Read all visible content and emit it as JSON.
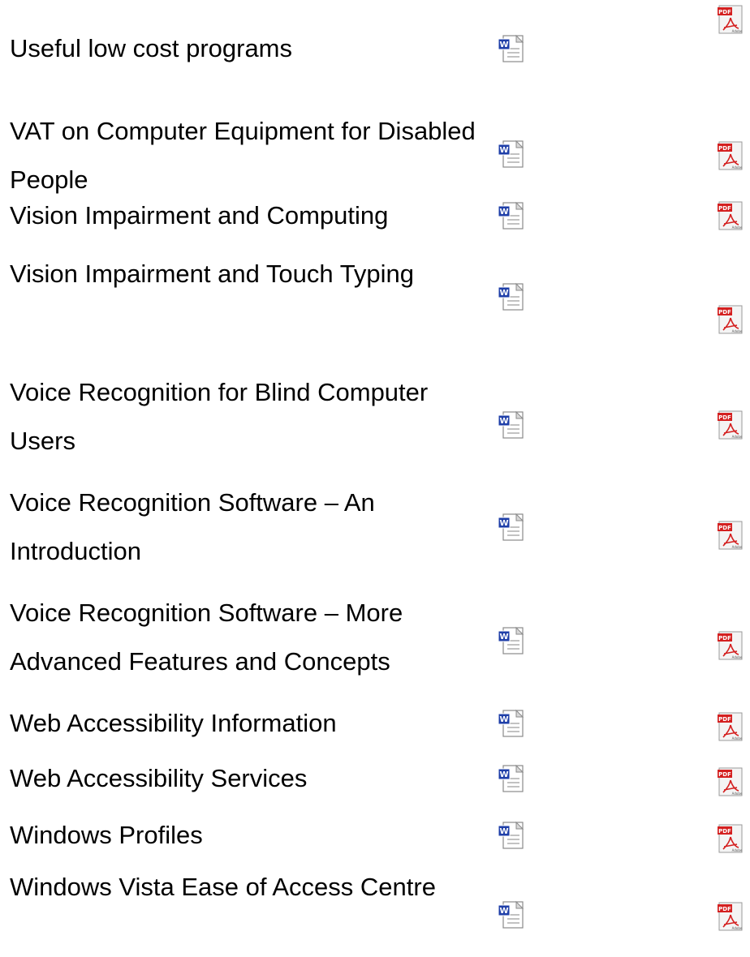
{
  "documents": [
    {
      "title": "Useful low cost programs",
      "word_icon": "word-document-icon",
      "pdf_icon": "pdf-document-icon"
    },
    {
      "title": "VAT on Computer Equipment for Disabled People",
      "word_icon": "word-document-icon",
      "pdf_icon": "pdf-document-icon"
    },
    {
      "title": "Vision Impairment and Computing",
      "word_icon": "word-document-icon",
      "pdf_icon": "pdf-document-icon"
    },
    {
      "title": "Vision Impairment and Touch Typing",
      "word_icon": "word-document-icon",
      "pdf_icon": "pdf-document-icon"
    },
    {
      "title": "Voice Recognition for Blind Computer Users",
      "word_icon": "word-document-icon",
      "pdf_icon": "pdf-document-icon"
    },
    {
      "title": "Voice Recognition Software – An Introduction",
      "word_icon": "word-document-icon",
      "pdf_icon": "pdf-document-icon"
    },
    {
      "title": "Voice Recognition Software – More Advanced Features and Concepts",
      "word_icon": "word-document-icon",
      "pdf_icon": "pdf-document-icon"
    },
    {
      "title": "Web Accessibility Information",
      "word_icon": "word-document-icon",
      "pdf_icon": "pdf-document-icon"
    },
    {
      "title": "Web Accessibility Services",
      "word_icon": "word-document-icon",
      "pdf_icon": "pdf-document-icon"
    },
    {
      "title": "Windows Profiles",
      "word_icon": "word-document-icon",
      "pdf_icon": "pdf-document-icon"
    },
    {
      "title": "Windows Vista Ease of Access Centre",
      "word_icon": "word-document-icon",
      "pdf_icon": "pdf-document-icon"
    }
  ],
  "icons": {
    "word_label": "W",
    "pdf_label": "PDF",
    "pdf_brand": "Adobe",
    "pdf_red": "#d42020",
    "word_blue": "#1f3fa8"
  }
}
